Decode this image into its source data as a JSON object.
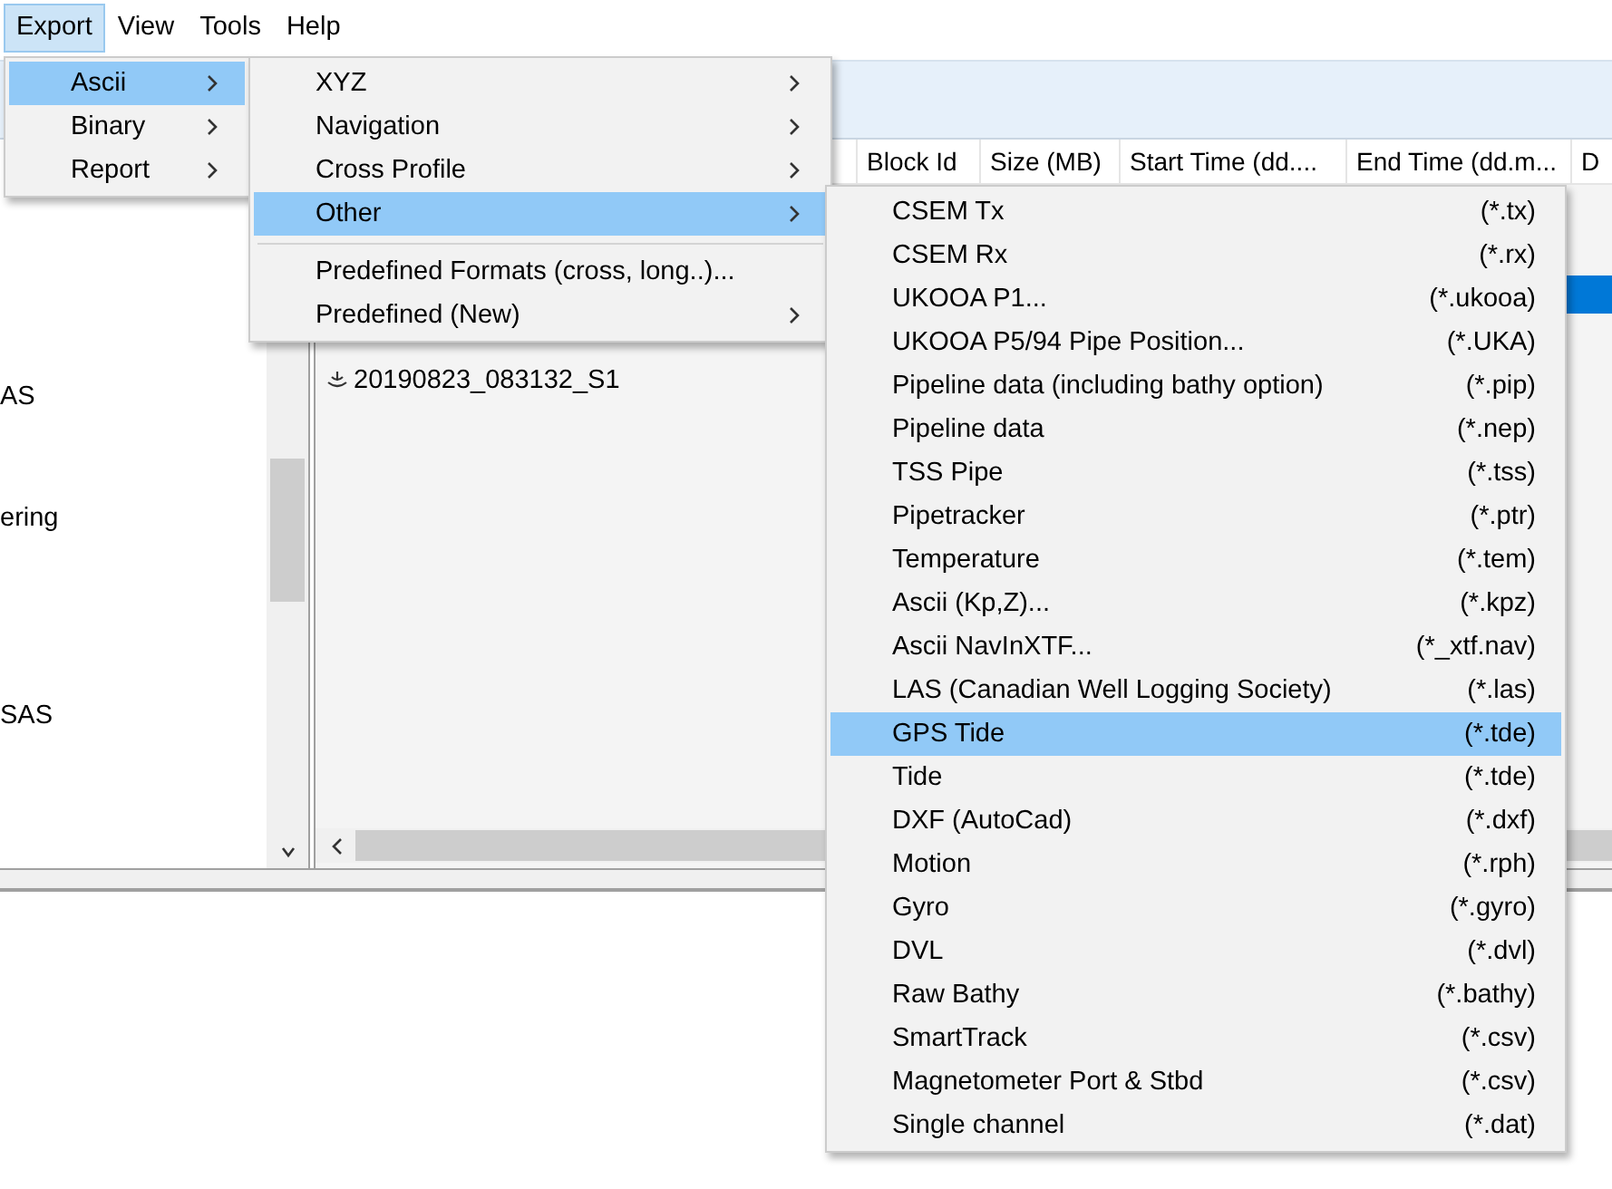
{
  "menubar": [
    {
      "label": "Export",
      "selected": true
    },
    {
      "label": "View",
      "selected": false
    },
    {
      "label": "Tools",
      "selected": false
    },
    {
      "label": "Help",
      "selected": false
    }
  ],
  "left_panel": {
    "items": [
      "AS",
      "ering",
      "SAS"
    ]
  },
  "table": {
    "columns": [
      "Block Id",
      "Size (MB)",
      "Start Time (dd....",
      "End Time (dd.m...",
      "D"
    ],
    "rows": [
      {
        "selected": true
      }
    ]
  },
  "file_list": [
    {
      "label": "20190823_083132_S1"
    }
  ],
  "menus": [
    {
      "items": [
        {
          "kind": "item",
          "label": "Ascii",
          "submenu": true,
          "selected": true
        },
        {
          "kind": "item",
          "label": "Binary",
          "submenu": true,
          "selected": false
        },
        {
          "kind": "item",
          "label": "Report",
          "submenu": true,
          "selected": false
        }
      ]
    },
    {
      "items": [
        {
          "kind": "item",
          "label": "XYZ",
          "submenu": true,
          "selected": false
        },
        {
          "kind": "item",
          "label": "Navigation",
          "submenu": true,
          "selected": false
        },
        {
          "kind": "item",
          "label": "Cross Profile",
          "submenu": true,
          "selected": false
        },
        {
          "kind": "item",
          "label": "Other",
          "submenu": true,
          "selected": true
        },
        {
          "kind": "separator"
        },
        {
          "kind": "item",
          "label": "Predefined Formats (cross, long..)...",
          "submenu": false,
          "selected": false
        },
        {
          "kind": "item",
          "label": "Predefined (New)",
          "submenu": true,
          "selected": false
        }
      ]
    },
    {
      "items": [
        {
          "kind": "item",
          "label": "CSEM Tx",
          "extension": "(*.tx)",
          "selected": false
        },
        {
          "kind": "item",
          "label": "CSEM Rx",
          "extension": "(*.rx)",
          "selected": false
        },
        {
          "kind": "item",
          "label": "UKOOA  P1...",
          "extension": "(*.ukooa)",
          "selected": false
        },
        {
          "kind": "item",
          "label": "UKOOA P5/94 Pipe Position...",
          "extension": "(*.UKA)",
          "selected": false
        },
        {
          "kind": "item",
          "label": "Pipeline data (including bathy option)",
          "extension": "(*.pip)",
          "selected": false
        },
        {
          "kind": "item",
          "label": "Pipeline data",
          "extension": "(*.nep)",
          "selected": false
        },
        {
          "kind": "item",
          "label": "TSS Pipe",
          "extension": "(*.tss)",
          "selected": false
        },
        {
          "kind": "item",
          "label": "Pipetracker",
          "extension": "(*.ptr)",
          "selected": false
        },
        {
          "kind": "item",
          "label": "Temperature",
          "extension": "(*.tem)",
          "selected": false
        },
        {
          "kind": "item",
          "label": "Ascii (Kp,Z)...",
          "extension": "(*.kpz)",
          "selected": false
        },
        {
          "kind": "item",
          "label": "Ascii NavInXTF...",
          "extension": "(*_xtf.nav)",
          "selected": false
        },
        {
          "kind": "item",
          "label": "LAS (Canadian Well Logging Society)",
          "extension": "(*.las)",
          "selected": false
        },
        {
          "kind": "item",
          "label": "GPS Tide",
          "extension": "(*.tde)",
          "selected": true
        },
        {
          "kind": "item",
          "label": "Tide",
          "extension": "(*.tde)",
          "selected": false
        },
        {
          "kind": "item",
          "label": "DXF (AutoCad)",
          "extension": "(*.dxf)",
          "selected": false
        },
        {
          "kind": "item",
          "label": "Motion",
          "extension": "(*.rph)",
          "selected": false
        },
        {
          "kind": "item",
          "label": "Gyro",
          "extension": "(*.gyro)",
          "selected": false
        },
        {
          "kind": "item",
          "label": "DVL",
          "extension": "(*.dvl)",
          "selected": false
        },
        {
          "kind": "item",
          "label": "Raw Bathy",
          "extension": "(*.bathy)",
          "selected": false
        },
        {
          "kind": "item",
          "label": "SmartTrack",
          "extension": "(*.csv)",
          "selected": false
        },
        {
          "kind": "item",
          "label": "Magnetometer Port & Stbd",
          "extension": "(*.csv)",
          "selected": false
        },
        {
          "kind": "item",
          "label": "Single channel",
          "extension": "(*.dat)",
          "selected": false
        }
      ]
    }
  ]
}
